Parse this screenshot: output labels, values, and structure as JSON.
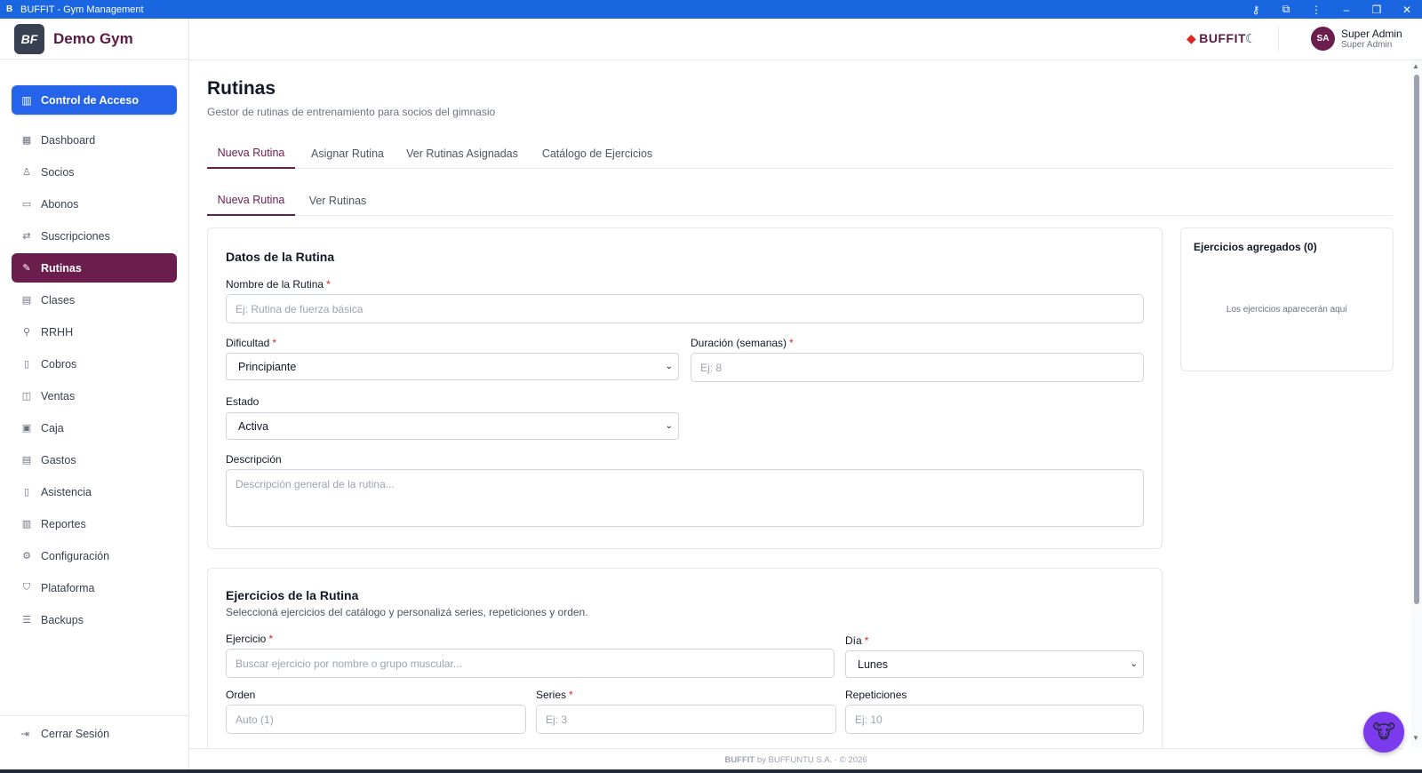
{
  "window": {
    "title": "BUFFIT - Gym Management",
    "app_mark": "B"
  },
  "sidebar": {
    "brand_name": "Demo Gym",
    "brand_logo": "BF",
    "access_button": "Control de Acceso",
    "items": [
      {
        "label": "Dashboard",
        "icon": "grid-icon"
      },
      {
        "label": "Socios",
        "icon": "users-icon"
      },
      {
        "label": "Abonos",
        "icon": "card-icon"
      },
      {
        "label": "Suscripciones",
        "icon": "repeat-icon"
      },
      {
        "label": "Rutinas",
        "icon": "dumbbell-icon",
        "active": true
      },
      {
        "label": "Clases",
        "icon": "calendar-icon"
      },
      {
        "label": "RRHH",
        "icon": "user-key-icon"
      },
      {
        "label": "Cobros",
        "icon": "clipboard-icon"
      },
      {
        "label": "Ventas",
        "icon": "bag-icon"
      },
      {
        "label": "Caja",
        "icon": "wallet-icon"
      },
      {
        "label": "Gastos",
        "icon": "receipt-icon"
      },
      {
        "label": "Asistencia",
        "icon": "check-clipboard-icon"
      },
      {
        "label": "Reportes",
        "icon": "bar-chart-icon"
      },
      {
        "label": "Configuración",
        "icon": "gear-icon"
      },
      {
        "label": "Plataforma",
        "icon": "shield-icon"
      },
      {
        "label": "Backups",
        "icon": "database-icon"
      }
    ],
    "logout": "Cerrar Sesión"
  },
  "header": {
    "logo_text": "BUFFIT",
    "avatar_initials": "SA",
    "user_name": "Super Admin",
    "user_role": "Super Admin"
  },
  "page": {
    "title": "Rutinas",
    "subtitle": "Gestor de rutinas de entrenamiento para socios del gimnasio",
    "tabs": [
      "Nueva Rutina",
      "Asignar Rutina",
      "Ver Rutinas Asignadas",
      "Catálogo de Ejercicios"
    ],
    "subtabs": [
      "Nueva Rutina",
      "Ver Rutinas"
    ]
  },
  "routine_form": {
    "title": "Datos de la Rutina",
    "name_label": "Nombre de la Rutina",
    "name_placeholder": "Ej: Rutina de fuerza básica",
    "difficulty_label": "Dificultad",
    "difficulty_value": "Principiante",
    "duration_label": "Duración (semanas)",
    "duration_placeholder": "Ej: 8",
    "status_label": "Estado",
    "status_value": "Activa",
    "description_label": "Descripción",
    "description_placeholder": "Descripción general de la rutina..."
  },
  "exercises_panel": {
    "title": "Ejercicios agregados (0)",
    "empty_text": "Los ejercicios aparecerán aquí"
  },
  "exercises_form": {
    "title": "Ejercicios de la Rutina",
    "subtitle": "Seleccioná ejercicios del catálogo y personalizá series, repeticiones y orden.",
    "exercise_label": "Ejercicio",
    "exercise_placeholder": "Buscar ejercicio por nombre o grupo muscular...",
    "day_label": "Día",
    "day_value": "Lunes",
    "order_label": "Orden",
    "order_placeholder": "Auto (1)",
    "series_label": "Series",
    "series_placeholder": "Ej: 3",
    "reps_label": "Repeticiones",
    "reps_placeholder": "Ej: 10"
  },
  "footer": {
    "brand": "BUFFIT",
    "text": " by BUFFUNTU S.A. · © 2026"
  },
  "colors": {
    "primary": "#6b1d4e",
    "accent_blue": "#2563eb",
    "titlebar": "#1a66e0"
  }
}
